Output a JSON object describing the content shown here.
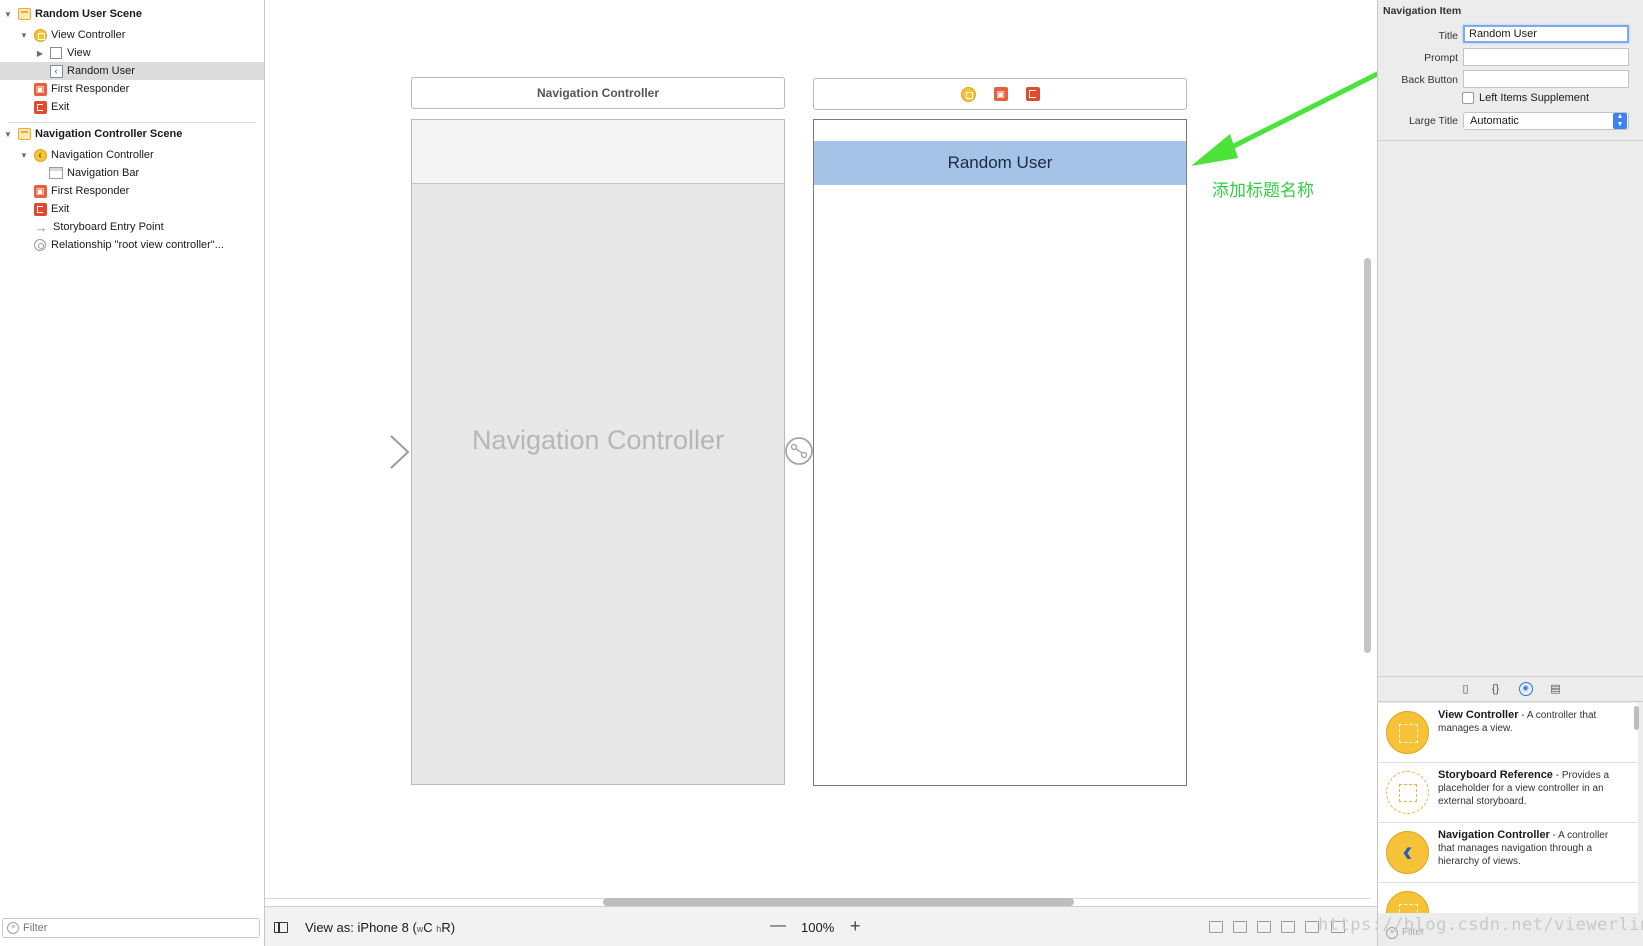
{
  "outline": {
    "rows": [
      {
        "label": "Random User Scene"
      },
      {
        "label": "View Controller"
      },
      {
        "label": "View"
      },
      {
        "label": "Random User"
      },
      {
        "label": "First Responder"
      },
      {
        "label": "Exit"
      },
      {
        "label": "Navigation Controller Scene"
      },
      {
        "label": "Navigation Controller"
      },
      {
        "label": "Navigation Bar"
      },
      {
        "label": "First Responder"
      },
      {
        "label": "Exit"
      },
      {
        "label": "Storyboard Entry Point"
      },
      {
        "label": "Relationship \"root view controller\"..."
      }
    ],
    "filter_placeholder": "Filter"
  },
  "canvas": {
    "nav_scene_header": "Navigation Controller",
    "nav_controller_placeholder": "Navigation Controller",
    "vc_nav_title": "Random User",
    "annotation": "添加标题名称",
    "annotation_color": "#34cc44"
  },
  "bottom_bar": {
    "view_as_prefix": "View as: iPhone 8 (",
    "view_as_w": "w",
    "view_as_c": "C",
    "view_as_h": "h",
    "view_as_r": "R)",
    "zoom_minus": "—",
    "zoom": "100%",
    "zoom_plus": "+"
  },
  "inspector": {
    "section_title": "Navigation Item",
    "fields": {
      "title_label": "Title",
      "title_value": "Random User",
      "prompt_label": "Prompt",
      "prompt_value": "",
      "back_button_label": "Back Button",
      "back_button_value": "",
      "left_items_label": "Left Items Supplement",
      "large_title_label": "Large Title",
      "large_title_value": "Automatic"
    },
    "library": [
      {
        "name": "View Controller",
        "desc": " - A controller that manages a view."
      },
      {
        "name": "Storyboard Reference",
        "desc": " - Provides a placeholder for a view controller in an external storyboard."
      },
      {
        "name": "Navigation Controller",
        "desc": " - A controller that manages navigation through a hierarchy of views."
      }
    ],
    "filter_placeholder": "Filter"
  },
  "watermark": "https://blog.csdn.net/viewerlin",
  "colors": {
    "accent": "#1f7ae0",
    "selection": "#a4c3e6",
    "arrow": "#4be33a"
  }
}
